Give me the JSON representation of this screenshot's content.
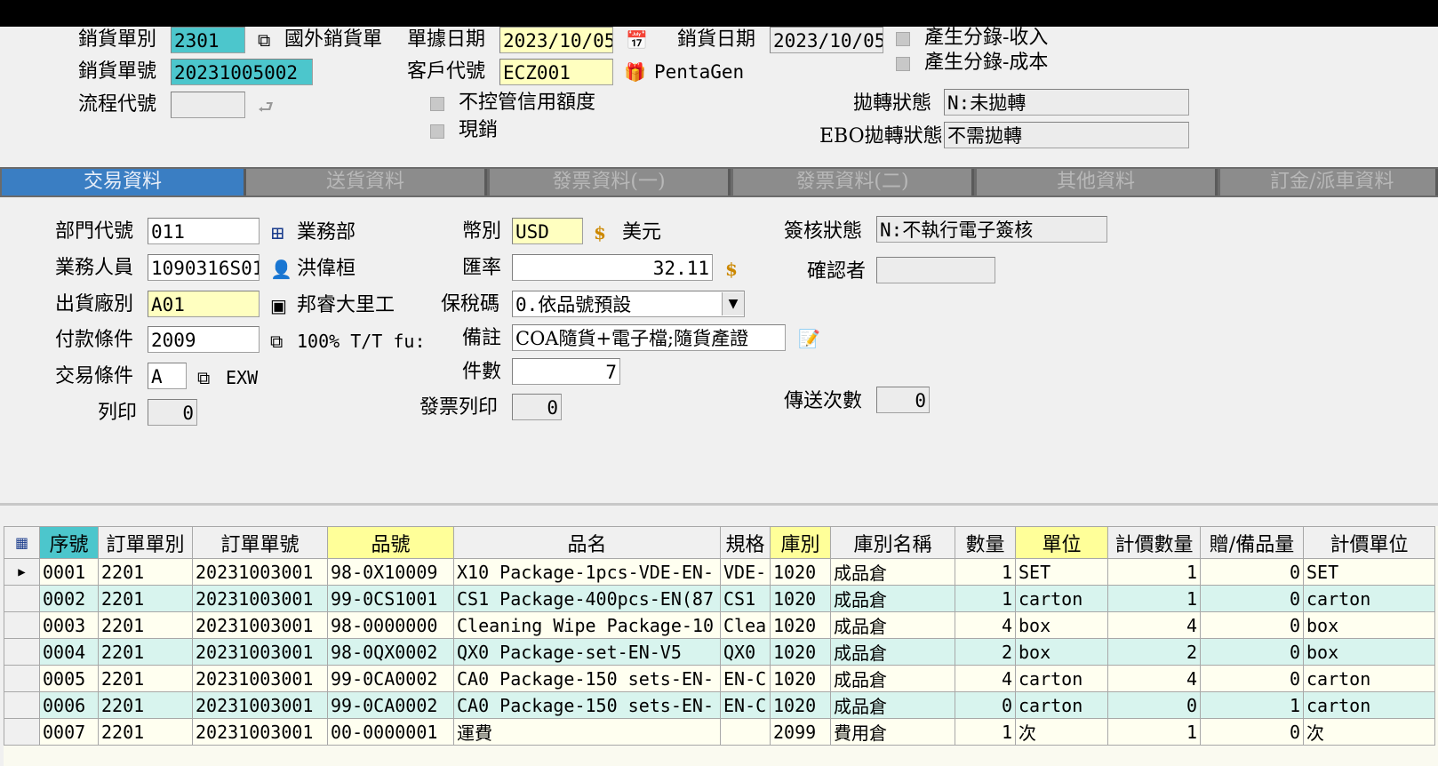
{
  "header": {
    "sales_type_label": "銷貨單別",
    "sales_type_value": "2301",
    "sales_type_desc": "國外銷貨單",
    "doc_date_label": "單據日期",
    "doc_date_value": "2023/10/05",
    "sales_date_label": "銷貨日期",
    "sales_date_value": "2023/10/05",
    "gen_entry_income": "產生分錄-收入",
    "gen_entry_cost": "產生分錄-成本",
    "sales_no_label": "銷貨單號",
    "sales_no_value": "20231005002",
    "customer_label": "客戶代號",
    "customer_value": "ECZ001",
    "customer_name": "PentaGen",
    "flow_label": "流程代號",
    "flow_value": "",
    "no_credit_control": "不控管信用額度",
    "cash_sale": "現銷",
    "transfer_status_label": "拋轉狀態",
    "transfer_status_value": "N:未拋轉",
    "ebo_status_label": "EBO拋轉狀態",
    "ebo_status_value": "不需拋轉"
  },
  "tabs": [
    "交易資料",
    "送貨資料",
    "發票資料(一)",
    "發票資料(二)",
    "其他資料",
    "訂金/派車資料"
  ],
  "form": {
    "dept_label": "部門代號",
    "dept_value": "011",
    "dept_name": "業務部",
    "staff_label": "業務人員",
    "staff_value": "1090316S01",
    "staff_name": "洪偉桓",
    "factory_label": "出貨廠別",
    "factory_value": "A01",
    "factory_name": "邦睿大里工",
    "pay_label": "付款條件",
    "pay_value": "2009",
    "pay_name": "100% T/T fu:",
    "trade_label": "交易條件",
    "trade_value": "A",
    "trade_name": "EXW",
    "print_label": "列印",
    "print_value": "0",
    "currency_label": "幣別",
    "currency_value": "USD",
    "currency_name": "美元",
    "rate_label": "匯率",
    "rate_value": "32.11",
    "tax_label": "保稅碼",
    "tax_value": "0.依品號預設",
    "note_label": "備註",
    "note_value": "COA隨貨+電子檔;隨貨產證",
    "pieces_label": "件數",
    "pieces_value": "7",
    "invoice_print_label": "發票列印",
    "invoice_print_value": "0",
    "sign_label": "簽核狀態",
    "sign_value": "N:不執行電子簽核",
    "confirm_label": "確認者",
    "confirm_value": "",
    "send_count_label": "傳送次數",
    "send_count_value": "0"
  },
  "grid": {
    "columns": [
      "序號",
      "訂單單別",
      "訂單單號",
      "品號",
      "品名",
      "規格",
      "庫別",
      "庫別名稱",
      "數量",
      "單位",
      "計價數量",
      "贈/備品量",
      "計價單位"
    ],
    "rows": [
      [
        "0001",
        "2201",
        "20231003001",
        "98-0X10009",
        "X10 Package-1pcs-VDE-EN-",
        "VDE-",
        "1020",
        "成品倉",
        "1",
        "SET",
        "1",
        "0",
        "SET"
      ],
      [
        "0002",
        "2201",
        "20231003001",
        "99-0CS1001",
        "CS1 Package-400pcs-EN(87",
        "CS1 ",
        "1020",
        "成品倉",
        "1",
        "carton",
        "1",
        "0",
        "carton"
      ],
      [
        "0003",
        "2201",
        "20231003001",
        "98-0000000",
        "Cleaning Wipe Package-10",
        "Clea",
        "1020",
        "成品倉",
        "4",
        "box",
        "4",
        "0",
        "box"
      ],
      [
        "0004",
        "2201",
        "20231003001",
        "98-0QX0002",
        "QX0 Package-set-EN-V5",
        "QX0 ",
        "1020",
        "成品倉",
        "2",
        "box",
        "2",
        "0",
        "box"
      ],
      [
        "0005",
        "2201",
        "20231003001",
        "99-0CA0002",
        "CA0 Package-150 sets-EN-",
        "EN-C",
        "1020",
        "成品倉",
        "4",
        "carton",
        "4",
        "0",
        "carton"
      ],
      [
        "0006",
        "2201",
        "20231003001",
        "99-0CA0002",
        "CA0 Package-150 sets-EN-",
        "EN-C",
        "1020",
        "成品倉",
        "0",
        "carton",
        "0",
        "1",
        "carton"
      ],
      [
        "0007",
        "2201",
        "20231003001",
        "00-0000001",
        "運費",
        "",
        "2099",
        "費用倉",
        "1",
        "次",
        "1",
        "0",
        "次"
      ]
    ]
  }
}
